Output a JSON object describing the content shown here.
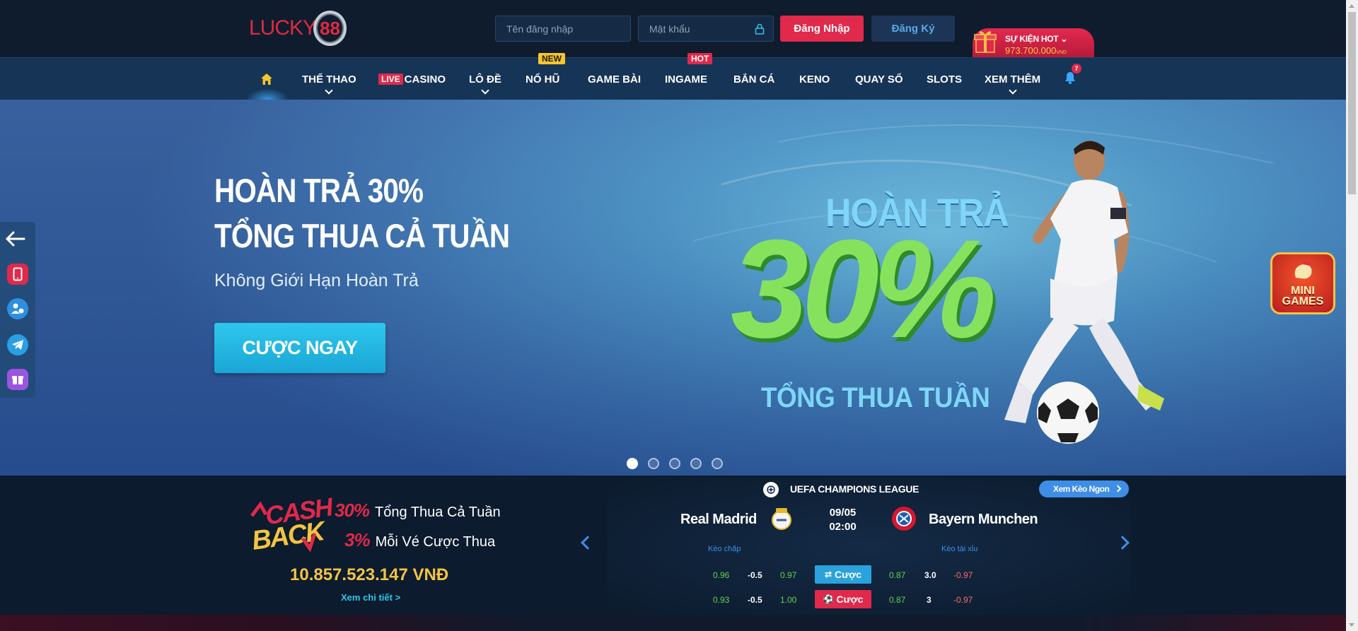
{
  "header": {
    "logo_text": "LUCKY",
    "logo_number": "88",
    "username_placeholder": "Tên đăng nhập",
    "password_placeholder": "Mật khẩu",
    "login_label": "Đăng Nhập",
    "register_label": "Đăng Ký",
    "event_title": "SỰ KIỆN HOT",
    "event_amount": "973.700.000",
    "event_currency": "VND"
  },
  "nav": {
    "items": [
      {
        "label": "THỂ THAO"
      },
      {
        "live": "LIVE",
        "label": "CASINO"
      },
      {
        "label": "LÔ ĐỀ"
      },
      {
        "label": "NỔ HŨ",
        "badge": "NEW"
      },
      {
        "label": "GAME BÀI"
      },
      {
        "label": "INGAME",
        "badge": "HOT"
      },
      {
        "label": "BẮN CÁ"
      },
      {
        "label": "KENO"
      },
      {
        "label": "QUAY SỐ"
      },
      {
        "label": "SLOTS"
      },
      {
        "label": "XEM THÊM"
      }
    ],
    "notification_count": "7"
  },
  "banner": {
    "title_line1": "HOÀN TRẢ 30%",
    "title_line2": "TỔNG THUA CẢ TUẦN",
    "subtitle": "Không Giới Hạn Hoàn Trả",
    "cta": "CƯỢC NGAY",
    "promo_top": "HOÀN TRẢ",
    "promo_big": "30%",
    "promo_bottom": "TỔNG THUA TUẦN",
    "slide_count": 5,
    "active_slide": 1
  },
  "mini_games": {
    "line1": "MINI",
    "line2": "GAMES"
  },
  "cashback": {
    "logo_word1": "CASH",
    "logo_word2": "BACK",
    "line1_pct": "30%",
    "line1_text": "Tổng Thua Cả Tuần",
    "line2_pct": "3%",
    "line2_text": "Mỗi Vé Cược Thua",
    "amount": "10.857.523.147 VNĐ",
    "link": "Xem chi tiết >"
  },
  "match": {
    "league": "UEFA CHAMPIONS LEAGUE",
    "odds_button": "Xem Kèo Ngon",
    "home_team": "Real Madrid",
    "away_team": "Bayern Munchen",
    "date": "09/05",
    "time": "02:00",
    "handicap_label": "Kèo chấp",
    "overunder_label": "Kèo tài xỉu",
    "row1": {
      "h1": "0.96",
      "h2": "-0.5",
      "h3": "0.97",
      "bet": "Cược",
      "o1": "0.87",
      "o2": "3.0",
      "o3": "-0.97"
    },
    "row2": {
      "h1": "0.93",
      "h2": "-0.5",
      "h3": "1.00",
      "bet": "Cược",
      "o1": "0.87",
      "o2": "3",
      "o3": "-0.97"
    }
  },
  "colors": {
    "brand_red": "#e0294b",
    "accent_blue": "#2ec7ec",
    "gold": "#f3c443",
    "header_bg": "#0e1c2e",
    "nav_bg": "#163456"
  }
}
